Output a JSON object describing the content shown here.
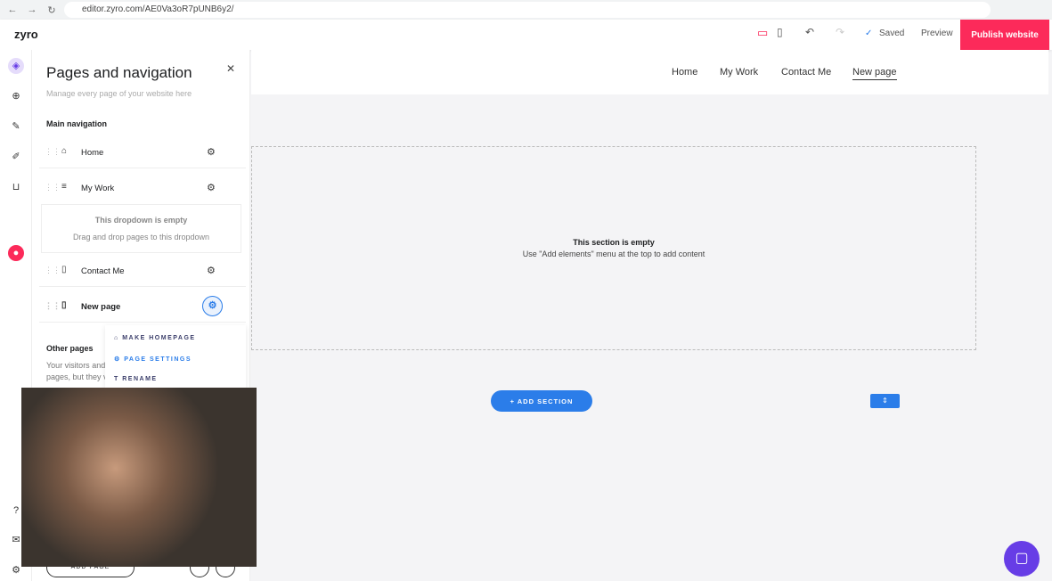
{
  "browser": {
    "url": "editor.zyro.com/AE0Va3oR7pUNB6y2/"
  },
  "topbar": {
    "logo": "zyro",
    "saved": "Saved",
    "preview": "Preview",
    "publish": "Publish website"
  },
  "panel": {
    "title": "Pages and navigation",
    "subtitle": "Manage every page of your website here",
    "main_nav": "Main navigation",
    "pages": [
      {
        "label": "Home",
        "icon": "home-icon"
      },
      {
        "label": "My Work",
        "icon": "dropdown-icon"
      },
      {
        "label": "Contact Me",
        "icon": "page-icon"
      },
      {
        "label": "New page",
        "icon": "page-icon"
      }
    ],
    "dropdown_empty": "This dropdown is empty",
    "dropdown_hint": "Drag and drop pages to this dropdown",
    "other_pages": "Other pages",
    "other_desc_1": "Your visitors and",
    "other_desc_2": "pages, but they v",
    "add_page": "ADD PAGE"
  },
  "context_menu": {
    "items": [
      "MAKE HOMEPAGE",
      "PAGE SETTINGS",
      "RENAME"
    ]
  },
  "site_nav": [
    "Home",
    "My Work",
    "Contact Me",
    "New page"
  ],
  "section": {
    "title": "This section is empty",
    "hint": "Use \"Add elements\" menu at the top to add content",
    "add_section": "+ ADD SECTION"
  },
  "colors": {
    "publish": "#fc2a5a",
    "accent": "#2b7de9",
    "purple": "#673de6"
  }
}
